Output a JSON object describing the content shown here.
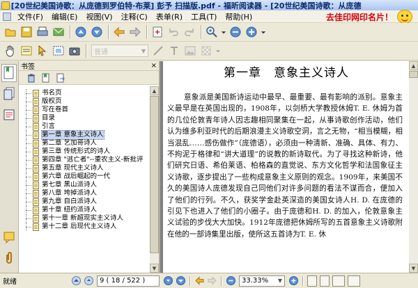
{
  "window": {
    "title": "[20世纪美国诗歌：从庞德到罗伯特·布莱] 彭予 扫描版.pdf - 福昕阅读器 - [20世纪美国诗歌：从庞德"
  },
  "menu": {
    "items": [
      "文件(F)",
      "编辑(E)",
      "视图(V)",
      "注释(C)",
      "表单(R)",
      "工具(T)",
      "帮助(H)"
    ],
    "ad_text": "去佳印网印名片！"
  },
  "toolbar": {
    "style_placeholder": "普通"
  },
  "bookmarks": {
    "header": "书签",
    "close": "×",
    "items": [
      "书名页",
      "版权页",
      "写在卷首",
      "目录",
      "引言",
      "第一章 意象主义诗人",
      "第二章 艺加哥诗人",
      "第三章 传统形式的诗人",
      "第四章 \"逃亡者\"--重农主义-新批评",
      "第五章 现代主义诗人",
      "第六章 战后崛起的一代",
      "第七章 黑山派诗人",
      "第八章 垮掉派诗人",
      "第九章 自白派诗人",
      "第十章 纽约派诗人",
      "第十一章 新超现实主义诗人",
      "第十二章 后现代主义诗人"
    ],
    "selected_index": 5
  },
  "document": {
    "chapter_title": "第一章　意象主义诗人",
    "paragraphs": [
      "意象派是美国新诗运动中最早、最重要、最有影响的派别。意象主义最早是在英国出现的，1908年，以剑桥大学教授休姆T. E. 休姆为首的几位伦敦青年诗人因志趣相同聚集在一起，从事诗歌创作活动，他们认为维多利亚时代的后期浪漫主义诗歌空洞，言之无物，“相当模糊，相当混乱……感伤做作”（庞德语），必须由一种清新、准确、具体、有力、不拘泥于格律和“讲大道理”的说教的新诗取代。为了寻找这种新诗，他们研究日语、希伯莱语、柏格森的直觉说、东方文化哲学和法国象征主义诗歌，逐步提出了一些构成意象主义原则的观念。1909年，来美国不久的美国诗人庞德发现自己同他们对许多问题的看法不谋而合，便加入了他们的行列。不久，获奖学金赴英深造的美国女诗人H. D. 在庞德的引见下也进入了他们的小圈子。由于庞德和H. D. 的加入，伦敦意象主义试验的步伐大大加快。1912年庞德把休姆所写的五首意象主义诗歌附在他的一部诗集里出版，使所这五首诗为T. E. 休"
    ]
  },
  "status": {
    "text": "就绪",
    "page_display": "9 ( 18 / 522 )",
    "zoom": "33.33%"
  },
  "colors": {
    "title_text": "#0b2a6e",
    "ad_text": "#d4000a",
    "selection": "#c9d7ef",
    "doc_background": "#808080"
  },
  "icons": {
    "toolbar1": [
      "open-icon",
      "save-icon",
      "print-icon",
      "email-icon",
      "page-up-icon",
      "page-down-icon",
      "back-icon",
      "forward-icon",
      "rotate-icon",
      "undo-icon",
      "redo-icon",
      "zoom-in-icon",
      "zoom-out-icon",
      "add-icon"
    ],
    "toolbar2": [
      "hand-icon",
      "select-text-icon",
      "select-icon",
      "snapshot-icon",
      "camera-icon",
      "shape-icon",
      "text-tool-icon",
      "image-tool-icon"
    ]
  }
}
